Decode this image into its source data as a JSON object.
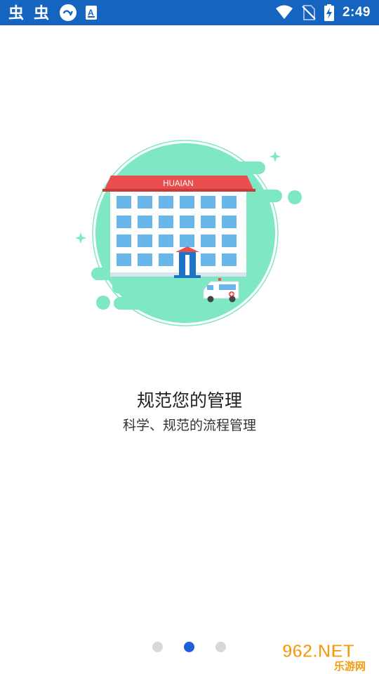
{
  "status_bar": {
    "time": "2:49",
    "left_icons": [
      "bug-icon",
      "bug-icon",
      "cloud-sync-icon",
      "accessibility-a-icon"
    ],
    "right_icons": [
      "wifi-icon",
      "no-sim-icon",
      "battery-charging-icon"
    ],
    "background_color": "#1565c0"
  },
  "illustration": {
    "building_sign": "HUAIAN",
    "circle_color": "#7ee8c5",
    "roof_color": "#e94e4e"
  },
  "content": {
    "title": "规范您的管理",
    "subtitle": "科学、规范的流程管理"
  },
  "pager": {
    "page_count": 3,
    "current_page": 2,
    "active_color": "#1e5ed9",
    "inactive_color": "#d8d8d8"
  },
  "watermark": {
    "main": "962.NET",
    "sub": "乐游网"
  }
}
